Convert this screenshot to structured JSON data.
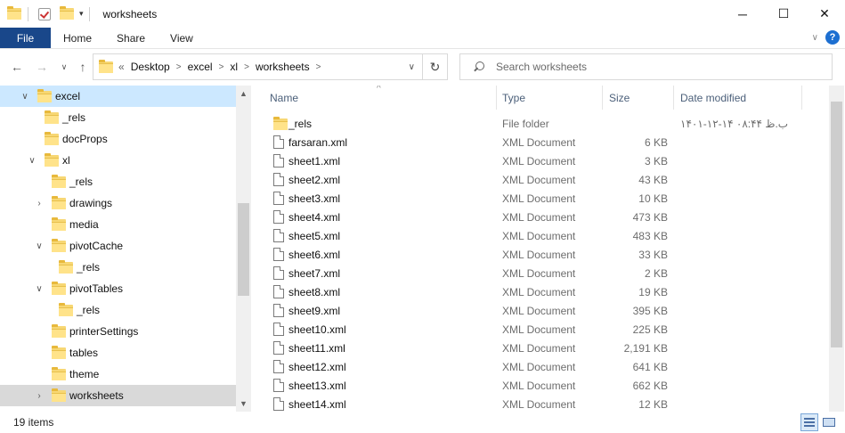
{
  "window": {
    "title": "worksheets",
    "minimize": "─",
    "maximize": "☐",
    "close": "✕"
  },
  "ribbon": {
    "tabs": [
      "File",
      "Home",
      "Share",
      "View"
    ],
    "collapse_icon": "chevron-down-icon",
    "help_label": "?"
  },
  "address": {
    "overflow": "«",
    "crumbs": [
      "Desktop",
      "excel",
      "xl",
      "worksheets"
    ]
  },
  "search": {
    "placeholder": "Search worksheets"
  },
  "tree": [
    {
      "label": "excel",
      "level": 0,
      "expander": "v"
    },
    {
      "label": "_rels",
      "level": 1,
      "expander": ""
    },
    {
      "label": "docProps",
      "level": 1,
      "expander": ""
    },
    {
      "label": "xl",
      "level": 1,
      "expander": "v"
    },
    {
      "label": "_rels",
      "level": 2,
      "expander": ""
    },
    {
      "label": "drawings",
      "level": 2,
      "expander": ">"
    },
    {
      "label": "media",
      "level": 2,
      "expander": ""
    },
    {
      "label": "pivotCache",
      "level": 2,
      "expander": "v"
    },
    {
      "label": "_rels",
      "level": 3,
      "expander": ""
    },
    {
      "label": "pivotTables",
      "level": 2,
      "expander": "v"
    },
    {
      "label": "_rels",
      "level": 3,
      "expander": ""
    },
    {
      "label": "printerSettings",
      "level": 2,
      "expander": ""
    },
    {
      "label": "tables",
      "level": 2,
      "expander": ""
    },
    {
      "label": "theme",
      "level": 2,
      "expander": ""
    },
    {
      "label": "worksheets",
      "level": 2,
      "expander": ">"
    }
  ],
  "columns": {
    "name": "Name",
    "type": "Type",
    "size": "Size",
    "date": "Date modified"
  },
  "files": [
    {
      "name": "_rels",
      "type": "File folder",
      "size": "",
      "date": "۱۴۰۱-۱۲-۱۴ ب.ظ ۰۸:۴۴",
      "kind": "folder"
    },
    {
      "name": "farsaran.xml",
      "type": "XML Document",
      "size": "6 KB",
      "date": "",
      "kind": "doc"
    },
    {
      "name": "sheet1.xml",
      "type": "XML Document",
      "size": "3 KB",
      "date": "",
      "kind": "doc"
    },
    {
      "name": "sheet2.xml",
      "type": "XML Document",
      "size": "43 KB",
      "date": "",
      "kind": "doc"
    },
    {
      "name": "sheet3.xml",
      "type": "XML Document",
      "size": "10 KB",
      "date": "",
      "kind": "doc"
    },
    {
      "name": "sheet4.xml",
      "type": "XML Document",
      "size": "473 KB",
      "date": "",
      "kind": "doc"
    },
    {
      "name": "sheet5.xml",
      "type": "XML Document",
      "size": "483 KB",
      "date": "",
      "kind": "doc"
    },
    {
      "name": "sheet6.xml",
      "type": "XML Document",
      "size": "33 KB",
      "date": "",
      "kind": "doc"
    },
    {
      "name": "sheet7.xml",
      "type": "XML Document",
      "size": "2 KB",
      "date": "",
      "kind": "doc"
    },
    {
      "name": "sheet8.xml",
      "type": "XML Document",
      "size": "19 KB",
      "date": "",
      "kind": "doc"
    },
    {
      "name": "sheet9.xml",
      "type": "XML Document",
      "size": "395 KB",
      "date": "",
      "kind": "doc"
    },
    {
      "name": "sheet10.xml",
      "type": "XML Document",
      "size": "225 KB",
      "date": "",
      "kind": "doc"
    },
    {
      "name": "sheet11.xml",
      "type": "XML Document",
      "size": "2,191 KB",
      "date": "",
      "kind": "doc"
    },
    {
      "name": "sheet12.xml",
      "type": "XML Document",
      "size": "641 KB",
      "date": "",
      "kind": "doc"
    },
    {
      "name": "sheet13.xml",
      "type": "XML Document",
      "size": "662 KB",
      "date": "",
      "kind": "doc"
    },
    {
      "name": "sheet14.xml",
      "type": "XML Document",
      "size": "12 KB",
      "date": "",
      "kind": "doc"
    }
  ],
  "status": {
    "count": "19 items"
  },
  "colors": {
    "file_tab": "#19478a",
    "selection": "#cce8ff",
    "folder": "#f7d774"
  }
}
